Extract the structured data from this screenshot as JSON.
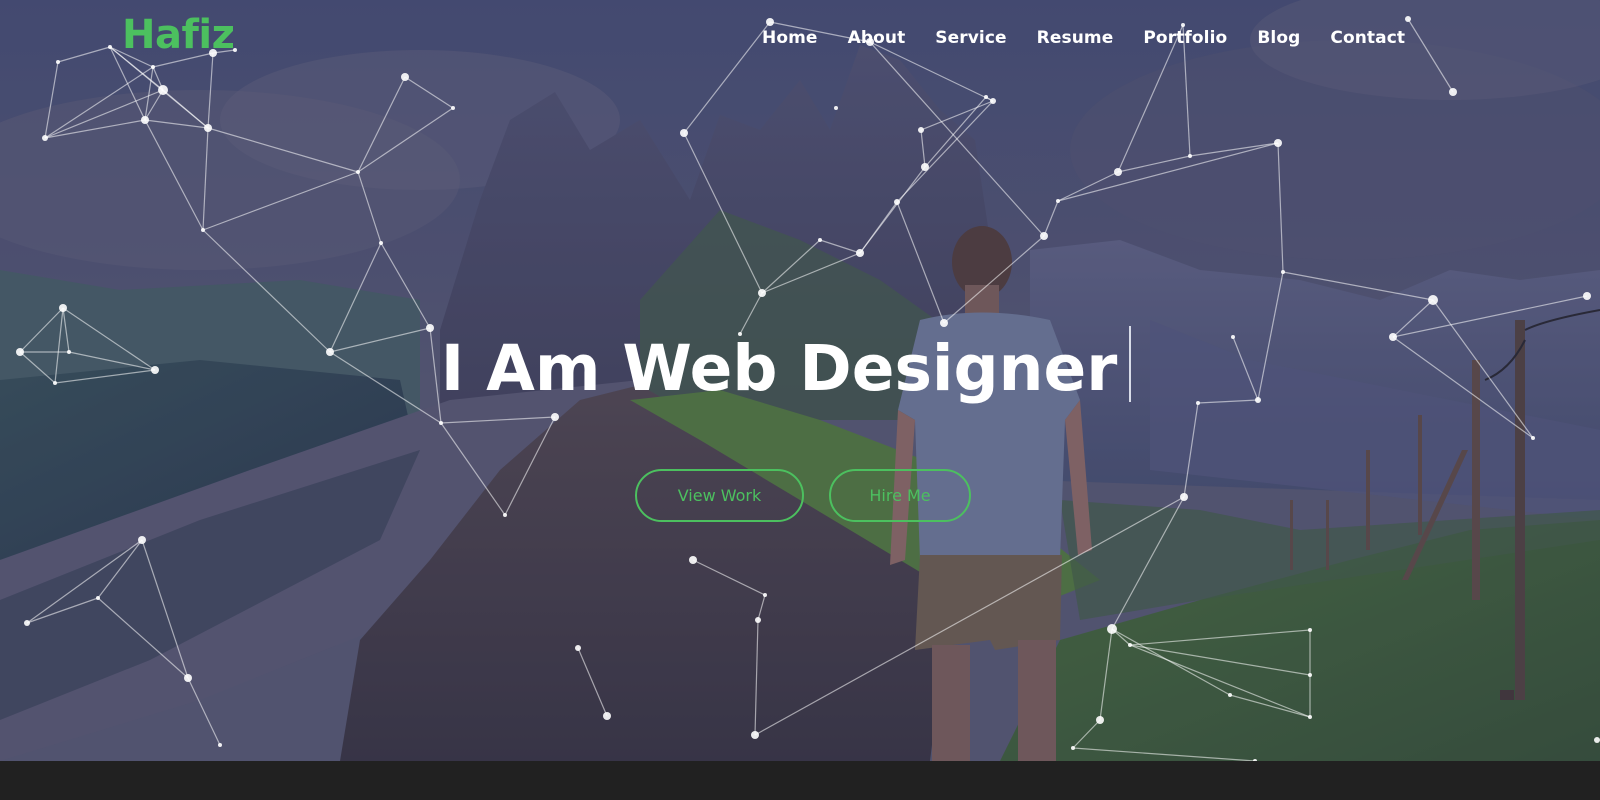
{
  "brand": {
    "logo_text": "Hafiz",
    "accent_color": "#4cc05f"
  },
  "nav": {
    "items": [
      {
        "label": "Home"
      },
      {
        "label": "About"
      },
      {
        "label": "Service"
      },
      {
        "label": "Resume"
      },
      {
        "label": "Portfolio"
      },
      {
        "label": "Blog"
      },
      {
        "label": "Contact"
      }
    ]
  },
  "hero": {
    "title": "I Am Web Designer",
    "background": "mountain-landscape-with-hiker",
    "buttons": [
      {
        "label": "View Work"
      },
      {
        "label": "Hire Me"
      }
    ]
  },
  "colors": {
    "footer_bg": "#212121",
    "text": "#ffffff",
    "particle": "#ffffff"
  }
}
